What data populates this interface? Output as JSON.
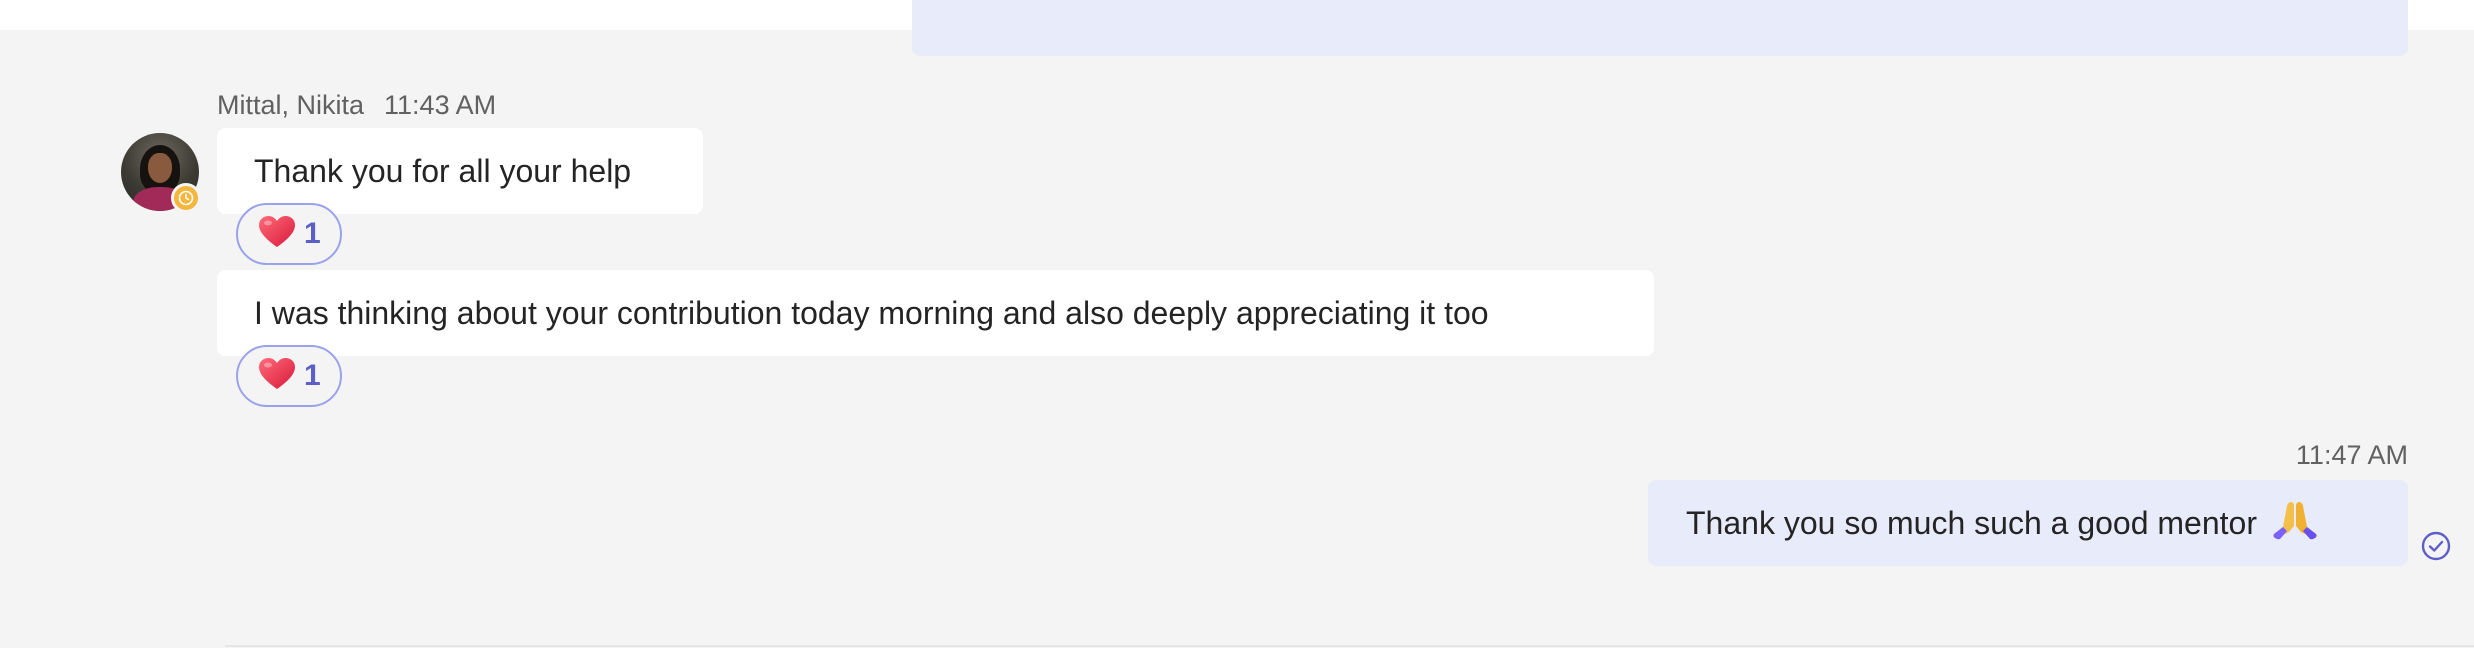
{
  "incoming": {
    "sender": "Mittal, Nikita",
    "time": "11:43 AM",
    "avatar_icon": "avatar-photo",
    "status_icon": "away-clock-icon",
    "messages": [
      {
        "text": "Thank you for all your help",
        "reaction": {
          "icon": "heart-icon",
          "count": "1"
        }
      },
      {
        "text": "I was thinking about your contribution today morning and also deeply appreciating it too",
        "reaction": {
          "icon": "heart-icon",
          "count": "1"
        }
      }
    ]
  },
  "outgoing": {
    "time": "11:47 AM",
    "text": "Thank you so much such a good mentor",
    "emoji_icon": "folded-hands-icon",
    "status_icon": "read-receipt-icon"
  },
  "colors": {
    "background": "#f4f4f4",
    "incoming_bubble": "#ffffff",
    "outgoing_bubble": "#e8ebfa",
    "accent": "#5b5fc7",
    "reaction_border": "#9aa2ea",
    "away_status": "#f4b63c"
  }
}
